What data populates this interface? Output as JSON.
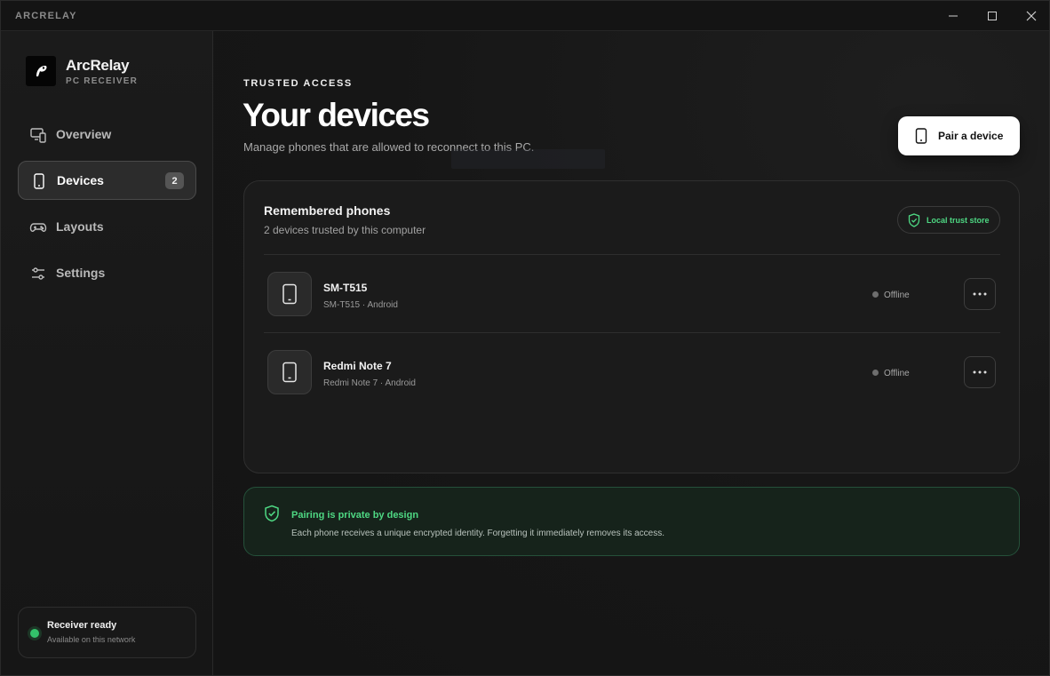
{
  "window": {
    "app_name": "ARCRELAY"
  },
  "brand": {
    "name": "ArcRelay",
    "subtitle": "PC RECEIVER"
  },
  "sidebar": {
    "items": [
      {
        "label": "Overview",
        "icon": "monitor-phone-icon",
        "active": false
      },
      {
        "label": "Devices",
        "icon": "phone-icon",
        "active": true,
        "badge": "2"
      },
      {
        "label": "Layouts",
        "icon": "gamepad-icon",
        "active": false
      },
      {
        "label": "Settings",
        "icon": "sliders-icon",
        "active": false
      }
    ],
    "status": {
      "title": "Receiver ready",
      "subtitle": "Available on this network",
      "color": "#33c26a"
    }
  },
  "header": {
    "eyebrow": "TRUSTED ACCESS",
    "title": "Your devices",
    "subtitle": "Manage phones that are allowed to reconnect to this PC.",
    "pair_button": "Pair a device"
  },
  "devices_card": {
    "title": "Remembered phones",
    "subtitle": "2 devices trusted by this computer",
    "trust_pill": "Local trust store",
    "devices": [
      {
        "name": "SM-T515",
        "meta": "SM-T515 · Android",
        "status": "Offline"
      },
      {
        "name": "Redmi Note 7",
        "meta": "Redmi Note 7 · Android",
        "status": "Offline"
      }
    ]
  },
  "privacy": {
    "title": "Pairing is private by design",
    "body": "Each phone receives a unique encrypted identity. Forgetting it immediately removes its access."
  },
  "colors": {
    "accent_green": "#4ed883",
    "background": "#141414"
  }
}
